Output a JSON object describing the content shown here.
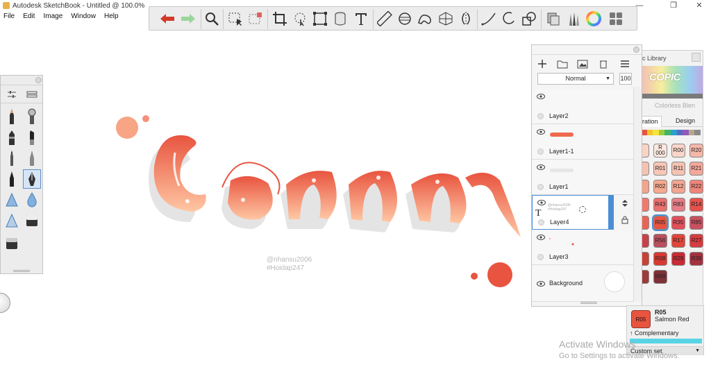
{
  "window": {
    "title": "Autodesk SketchBook - Untitled @ 100.0%",
    "controls": {
      "minimize": "—",
      "maximize": "❐",
      "close": "✕"
    }
  },
  "menu": [
    "File",
    "Edit",
    "Image",
    "Window",
    "Help"
  ],
  "toolbar": {
    "tools": [
      "undo",
      "redo",
      "zoom",
      "select",
      "select-add",
      "crop",
      "lasso",
      "transform",
      "bucket",
      "text",
      "ruler",
      "ellipse",
      "french-curve",
      "perspective",
      "symmetry",
      "stroke",
      "circle",
      "shape",
      "copic-library",
      "brush-library",
      "color-wheel",
      "layers-toggle"
    ]
  },
  "canvas": {
    "watermark_line1": "@nhansu2006",
    "watermark_line2": "#Hoidap247",
    "colors": {
      "lettering_top": "#e8543f",
      "lettering_bottom": "#ffc7a4",
      "shadow": "#e4e4e4"
    }
  },
  "layers": {
    "blend_mode": "Normal",
    "opacity": "100",
    "items": [
      {
        "name": "Layer2"
      },
      {
        "name": "Layer1-1"
      },
      {
        "name": "Layer1"
      },
      {
        "name": "Layer4",
        "thumb_line1": "@nhansu2006",
        "thumb_line2": "#Hoidap247"
      },
      {
        "name": "Layer3"
      }
    ],
    "background_label": "Background"
  },
  "copic": {
    "title": "ic Library",
    "logo": "COPIC",
    "blend_label": "Colorless Blen",
    "tabs": [
      "stration",
      "Design"
    ],
    "swatches": [
      {
        "code": "",
        "color": "#f8d4c6"
      },
      {
        "code": "R\n000",
        "color": "#fde8df"
      },
      {
        "code": "R00",
        "color": "#f9d6c9"
      },
      {
        "code": "R20",
        "color": "#f5b7a8"
      },
      {
        "code": "",
        "color": "#f5c3b0"
      },
      {
        "code": "R01",
        "color": "#f7c6b6"
      },
      {
        "code": "R11",
        "color": "#f6c2b1"
      },
      {
        "code": "R21",
        "color": "#f4a79a"
      },
      {
        "code": "",
        "color": "#f2a58c"
      },
      {
        "code": "R02",
        "color": "#f5a98f"
      },
      {
        "code": "R12",
        "color": "#f3a58f"
      },
      {
        "code": "R22",
        "color": "#ef8579"
      },
      {
        "code": "",
        "color": "#ee7b6e"
      },
      {
        "code": "R43",
        "color": "#ea6f6e"
      },
      {
        "code": "R83",
        "color": "#e77d86"
      },
      {
        "code": "R14",
        "color": "#e4524b"
      },
      {
        "code": "",
        "color": "#e76556"
      },
      {
        "code": "R05",
        "color": "#e8543f"
      },
      {
        "code": "R35",
        "color": "#e1505a"
      },
      {
        "code": "R85",
        "color": "#c9515f"
      },
      {
        "code": "",
        "color": "#c6424b"
      },
      {
        "code": "R56",
        "color": "#b94f5c"
      },
      {
        "code": "R17",
        "color": "#e1463a"
      },
      {
        "code": "R27",
        "color": "#d63c3f"
      },
      {
        "code": "",
        "color": "#c74135"
      },
      {
        "code": "R08",
        "color": "#d83a33"
      },
      {
        "code": "R29",
        "color": "#c82b35"
      },
      {
        "code": "R39",
        "color": "#a4333f"
      },
      {
        "code": "",
        "color": "#9b3b3a"
      },
      {
        "code": "R89",
        "color": "#7e3238"
      }
    ],
    "strip": [
      "#e8543f",
      "#f2c42d",
      "#f6e33a",
      "#9ccc3c",
      "#3fb46a",
      "#2e9fcf",
      "#5a69c4",
      "#8e5bb8",
      "#b8a68a",
      "#8a8a8a"
    ]
  },
  "color_info": {
    "code": "R05",
    "name": "Salmon Red",
    "swatch_label": "R05",
    "complementary": "↑ Complementary",
    "set": "Custom set",
    "swatch_color": "#e8543f",
    "comp_color": "#59d4e4"
  },
  "os": {
    "activate": "Activate Windows",
    "activate_sub": "Go to Settings to activate Windows."
  }
}
